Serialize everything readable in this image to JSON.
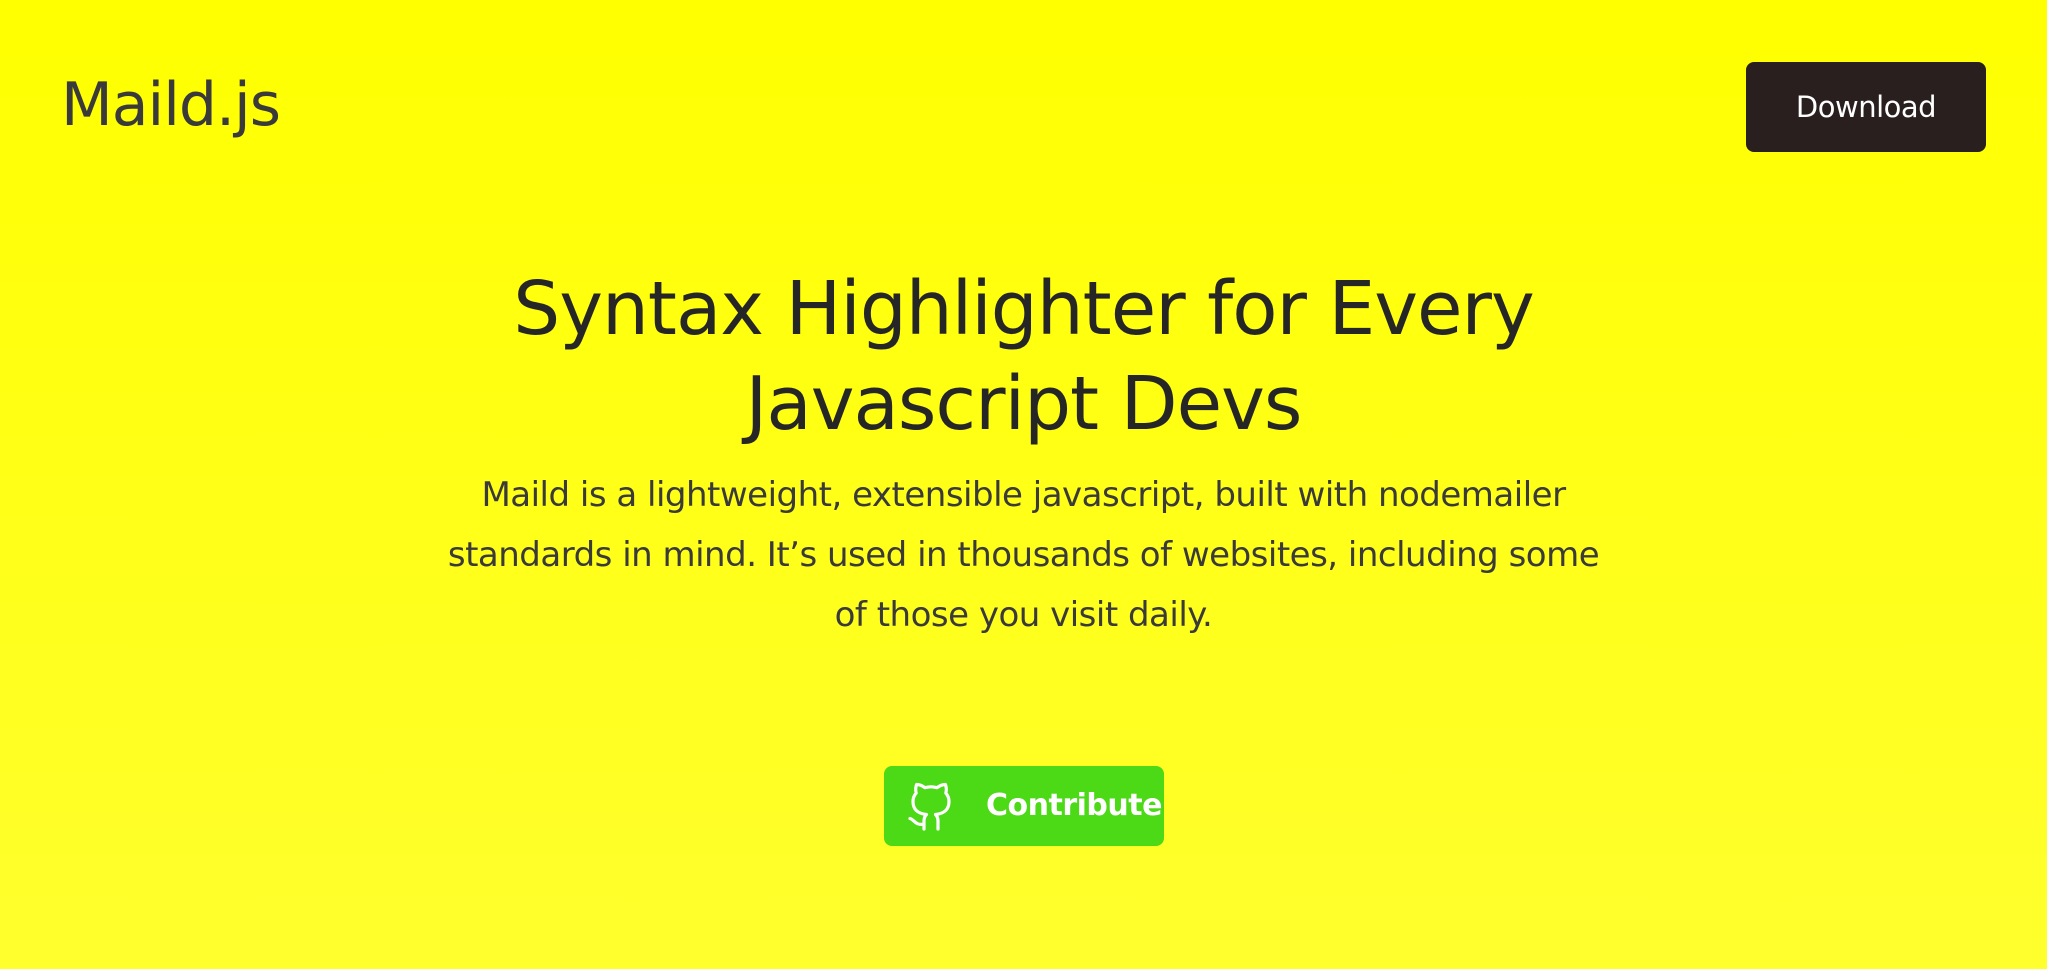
{
  "header": {
    "logo_text": "Maild.js",
    "download_label": "Download"
  },
  "hero": {
    "title_lines": [
      "Syntax Highlighter for Every",
      "Javascript Devs"
    ],
    "subtitle_lines": [
      "Maild is a lightweight, extensible javascript, built with nodemailer",
      "standards in mind. It’s used in thousands of websites, including some",
      "of those you visit daily."
    ],
    "contribute_label": "Contribute",
    "contribute_icon": "github-icon"
  },
  "colors": {
    "background": "#ffff00",
    "download_button": "#2a1f1f",
    "contribute_button": "#4cd916",
    "text_dark": "#262626"
  }
}
